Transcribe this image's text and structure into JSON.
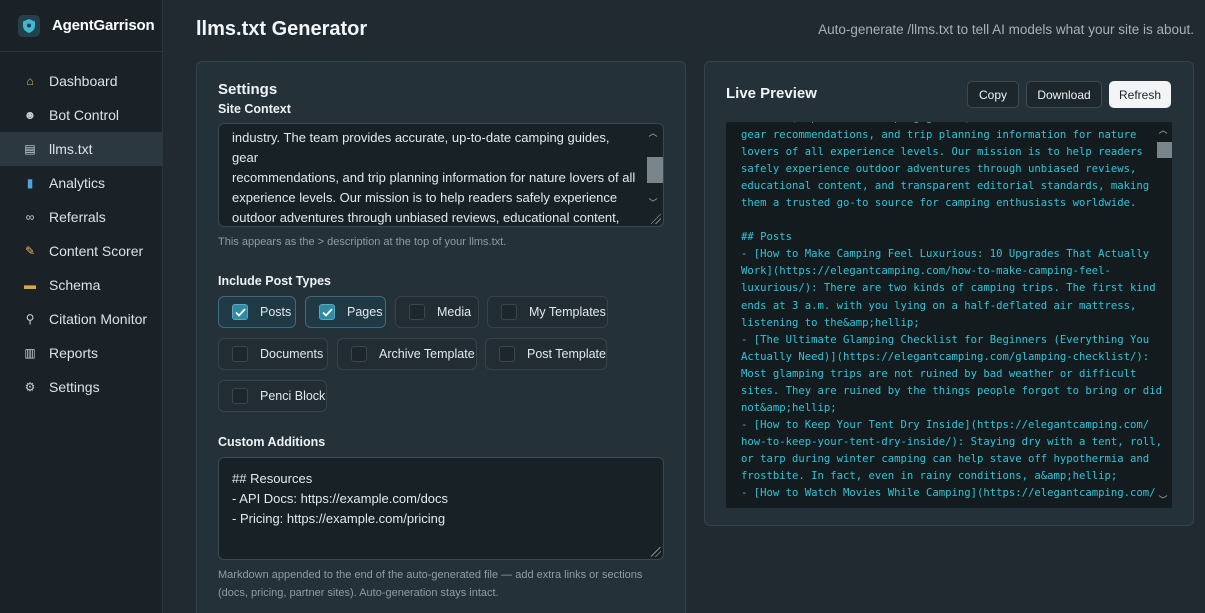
{
  "brand": {
    "name": "AgentGarrison"
  },
  "nav": [
    {
      "label": "Dashboard",
      "icon": "home-icon",
      "glyph": "⌂",
      "color": "#e3b86a"
    },
    {
      "label": "Bot Control",
      "icon": "robot-icon",
      "glyph": "☻",
      "color": "#c9d2d6"
    },
    {
      "label": "llms.txt",
      "icon": "document-icon",
      "glyph": "▤",
      "color": "#c9d2d6"
    },
    {
      "label": "Analytics",
      "icon": "bar-chart-icon",
      "glyph": "▮",
      "color": "#4fa3d9"
    },
    {
      "label": "Referrals",
      "icon": "link-icon",
      "glyph": "∞",
      "color": "#c9d2d6"
    },
    {
      "label": "Content Scorer",
      "icon": "pencil-icon",
      "glyph": "✎",
      "color": "#e3b86a"
    },
    {
      "label": "Schema",
      "icon": "folder-icon",
      "glyph": "▬",
      "color": "#d6a84a"
    },
    {
      "label": "Citation Monitor",
      "icon": "magnifier-icon",
      "glyph": "⚲",
      "color": "#c9d2d6"
    },
    {
      "label": "Reports",
      "icon": "report-icon",
      "glyph": "▥",
      "color": "#c9d2d6"
    },
    {
      "label": "Settings",
      "icon": "gear-icon",
      "glyph": "⚙",
      "color": "#c9d2d6"
    }
  ],
  "header": {
    "title": "llms.txt Generator",
    "subtitle": "Auto-generate /llms.txt to tell AI models what your site is about."
  },
  "settings": {
    "title": "Settings",
    "site_context_label": "Site Context",
    "site_context_text": "industry. The team provides accurate, up-to-date camping guides, gear\nrecommendations, and trip planning information for nature lovers of all\nexperience levels. Our mission is to help readers safely experience\noutdoor adventures through unbiased reviews, educational content, and\ntransparent editorial standards, making them a trusted go-to source for",
    "site_context_help": "This appears as the > description at the top of your llms.txt.",
    "post_types_label": "Include Post Types",
    "post_types": [
      {
        "label": "Posts",
        "checked": true
      },
      {
        "label": "Pages",
        "checked": true
      },
      {
        "label": "Media",
        "checked": false
      },
      {
        "label": "My Templates",
        "checked": false
      },
      {
        "label": "Documents",
        "checked": false
      },
      {
        "label": "Archive Template",
        "checked": false
      },
      {
        "label": "Post Template",
        "checked": false
      },
      {
        "label": "Penci Block",
        "checked": false
      }
    ],
    "custom_label": "Custom Additions",
    "custom_text": "## Resources\n- API Docs: https://example.com/docs\n- Pricing: https://example.com/pricing",
    "custom_help": "Markdown appended to the end of the auto-generated file — add extra links or sections\n(docs, pricing, partner sites). Auto-generation stays intact."
  },
  "preview": {
    "title": "Live Preview",
    "copy_label": "Copy",
    "download_label": "Download",
    "refresh_label": "Refresh",
    "code": "accurate, up-to-date camping guides,\ngear recommendations, and trip planning information for nature\nlovers of all experience levels. Our mission is to help readers\nsafely experience outdoor adventures through unbiased reviews,\neducational content, and transparent editorial standards, making\nthem a trusted go-to source for camping enthusiasts worldwide.\n\n## Posts\n- [How to Make Camping Feel Luxurious: 10 Upgrades That Actually\nWork](https://elegantcamping.com/how-to-make-camping-feel-\nluxurious/): There are two kinds of camping trips. The first kind\nends at 3 a.m. with you lying on a half-deflated air mattress,\nlistening to the&amp;hellip;\n- [The Ultimate Glamping Checklist for Beginners (Everything You\nActually Need)](https://elegantcamping.com/glamping-checklist/):\nMost glamping trips are not ruined by bad weather or difficult\nsites. They are ruined by the things people forgot to bring or did\nnot&amp;hellip;\n- [How to Keep Your Tent Dry Inside](https://elegantcamping.com/\nhow-to-keep-your-tent-dry-inside/): Staying dry with a tent, roll,\nor tarp during winter camping can help stave off hypothermia and\nfrostbite. In fact, even in rainy conditions, a&amp;hellip;\n- [How to Watch Movies While Camping](https://elegantcamping.com/"
  },
  "colors": {
    "accent": "#2bc7d9",
    "checkbox": "#2f8aa3"
  }
}
